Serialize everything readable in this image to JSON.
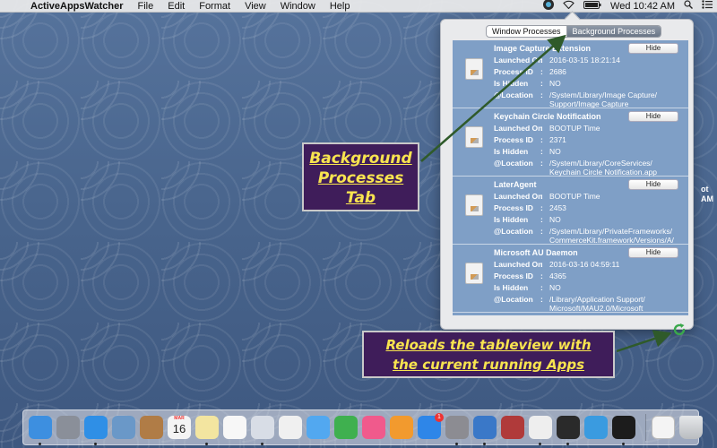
{
  "menubar": {
    "app_name": "ActiveAppsWatcher",
    "items": [
      "File",
      "Edit",
      "Format",
      "View",
      "Window",
      "Help"
    ],
    "clock": "Wed 10:42 AM"
  },
  "popover": {
    "tabs": [
      {
        "label": "Window Processes",
        "active": false
      },
      {
        "label": "Background Processes",
        "active": true
      }
    ],
    "fields": {
      "launched": "Launched On",
      "pid": "Process ID",
      "hidden": "Is Hidden",
      "location": "@Location"
    },
    "hide_label": "Hide",
    "rows": [
      {
        "title": "Image Capture Extension",
        "launched": "2016-03-15 18:21:14",
        "pid": "2686",
        "hidden": "NO",
        "location1": "/System/Library/Image Capture/",
        "location2": "Support/Image Capture"
      },
      {
        "title": "Keychain Circle Notification",
        "launched": "BOOTUP Time",
        "pid": "2371",
        "hidden": "NO",
        "location1": "/System/Library/CoreServices/",
        "location2": "Keychain Circle Notification.app"
      },
      {
        "title": "LaterAgent",
        "launched": "BOOTUP Time",
        "pid": "2453",
        "hidden": "NO",
        "location1": "/System/Library/PrivateFrameworks/",
        "location2": "CommerceKit.framework/Versions/A/"
      },
      {
        "title": "Microsoft AU Daemon",
        "launched": "2016-03-16 04:59:11",
        "pid": "4365",
        "hidden": "NO",
        "location1": "/Library/Application Support/",
        "location2": "Microsoft/MAU2.0/Microsoft"
      }
    ]
  },
  "annotations": {
    "tab_callout": [
      "Background",
      "Processes",
      "Tab"
    ],
    "reload_callout": [
      "Reloads the tableview with",
      "the current running Apps"
    ]
  },
  "desktop_edge_text": [
    "ot",
    "AM"
  ],
  "dock": {
    "icons": [
      {
        "name": "finder",
        "color": "#3d8fe0"
      },
      {
        "name": "launchpad",
        "color": "#8a8f99"
      },
      {
        "name": "safari",
        "color": "#2f8fe6"
      },
      {
        "name": "photo-preview",
        "color": "#6a98c8"
      },
      {
        "name": "contacts",
        "color": "#b07c46"
      },
      {
        "name": "calendar",
        "color": "#f4f4f4"
      },
      {
        "name": "notes",
        "color": "#f3e5a0"
      },
      {
        "name": "reminders",
        "color": "#f7f7f7"
      },
      {
        "name": "preview",
        "color": "#d8dde6"
      },
      {
        "name": "photos",
        "color": "#f0f0f0"
      },
      {
        "name": "messages",
        "color": "#52a8f0"
      },
      {
        "name": "facetime",
        "color": "#3fb04f"
      },
      {
        "name": "itunes",
        "color": "#f05a8c"
      },
      {
        "name": "ibooks",
        "color": "#f29a2e"
      },
      {
        "name": "app-store",
        "color": "#2e86e8"
      },
      {
        "name": "system-preferences",
        "color": "#8c8c92"
      },
      {
        "name": "xcode",
        "color": "#3a78c8"
      },
      {
        "name": "dictionary",
        "color": "#b03a3a"
      },
      {
        "name": "textedit",
        "color": "#eeeeee"
      },
      {
        "name": "activity-monitor",
        "color": "#2a2a2a"
      },
      {
        "name": "wave-app",
        "color": "#3a9be0"
      },
      {
        "name": "active-apps-watcher",
        "color": "#1c1c1c"
      }
    ],
    "calendar_day": "16",
    "calendar_month": "MAR",
    "appstore_badge": "1"
  }
}
